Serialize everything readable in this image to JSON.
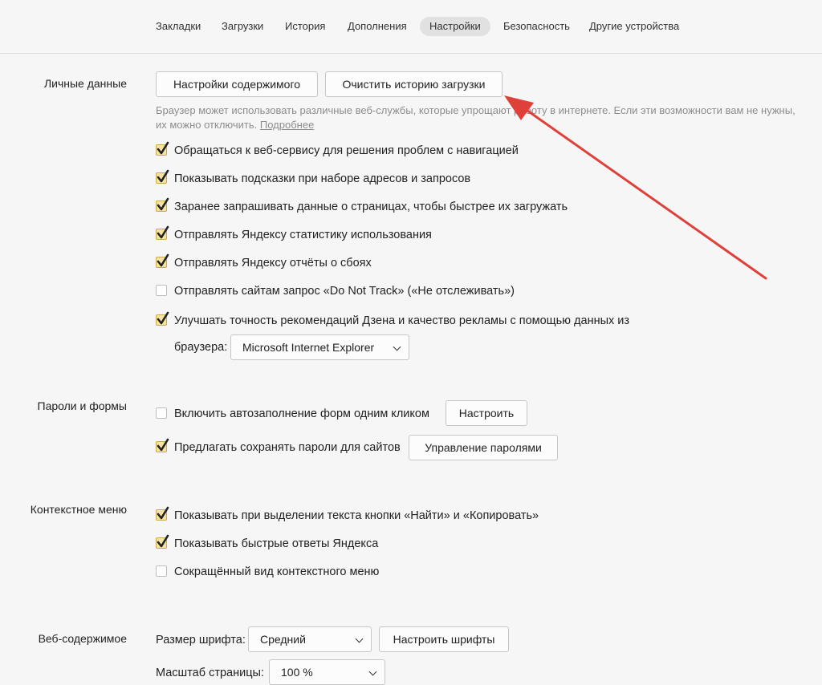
{
  "nav": {
    "tabs": [
      {
        "label": "Закладки"
      },
      {
        "label": "Загрузки"
      },
      {
        "label": "История"
      },
      {
        "label": "Дополнения"
      },
      {
        "label": "Настройки",
        "active": true
      },
      {
        "label": "Безопасность"
      },
      {
        "label": "Другие устройства"
      }
    ]
  },
  "personal": {
    "label": "Личные данные",
    "content_settings_button": "Настройки содержимого",
    "clear_history_button": "Очистить историю загрузки",
    "hint_text": "Браузер может использовать различные веб-службы, которые упрощают работу в интернете. Если эти возможности вам не нужны, их можно отключить. ",
    "hint_link": "Подробнее",
    "options": [
      {
        "label": "Обращаться к веб-сервису для решения проблем с навигацией",
        "checked": true
      },
      {
        "label": "Показывать подсказки при наборе адресов и запросов",
        "checked": true
      },
      {
        "label": "Заранее запрашивать данные о страницах, чтобы быстрее их загружать",
        "checked": true
      },
      {
        "label": "Отправлять Яндексу статистику использования",
        "checked": true
      },
      {
        "label": "Отправлять Яндексу отчёты о сбоях",
        "checked": true
      },
      {
        "label": "Отправлять сайтам запрос «Do Not Track» («Не отслеживать»)",
        "checked": false
      },
      {
        "label": "Улучшать точность рекомендаций Дзена и качество рекламы с помощью данных из",
        "checked": true
      }
    ],
    "browser_label": "браузера:",
    "browser_select": "Microsoft Internet Explorer"
  },
  "passwords": {
    "label": "Пароли и формы",
    "autofill_label": "Включить автозаполнение форм одним кликом",
    "autofill_checked": false,
    "configure_button": "Настроить",
    "save_passwords_label": "Предлагать сохранять пароли для сайтов",
    "save_passwords_checked": true,
    "manage_passwords_button": "Управление паролями"
  },
  "context_menu": {
    "label": "Контекстное меню",
    "options": [
      {
        "label": "Показывать при выделении текста кнопки «Найти» и «Копировать»",
        "checked": true
      },
      {
        "label": "Показывать быстрые ответы Яндекса",
        "checked": true
      },
      {
        "label": "Сокращённый вид контекстного меню",
        "checked": false
      }
    ]
  },
  "web_content": {
    "label": "Веб-содержимое",
    "font_size_label": "Размер шрифта:",
    "font_size_value": "Средний",
    "configure_fonts_button": "Настроить шрифты",
    "zoom_label": "Масштаб страницы:",
    "zoom_value": "100 %"
  },
  "colors": {
    "arrow": "#e0403a",
    "checkbox_fill": "#f4e3a3",
    "check_mark": "#222222"
  }
}
